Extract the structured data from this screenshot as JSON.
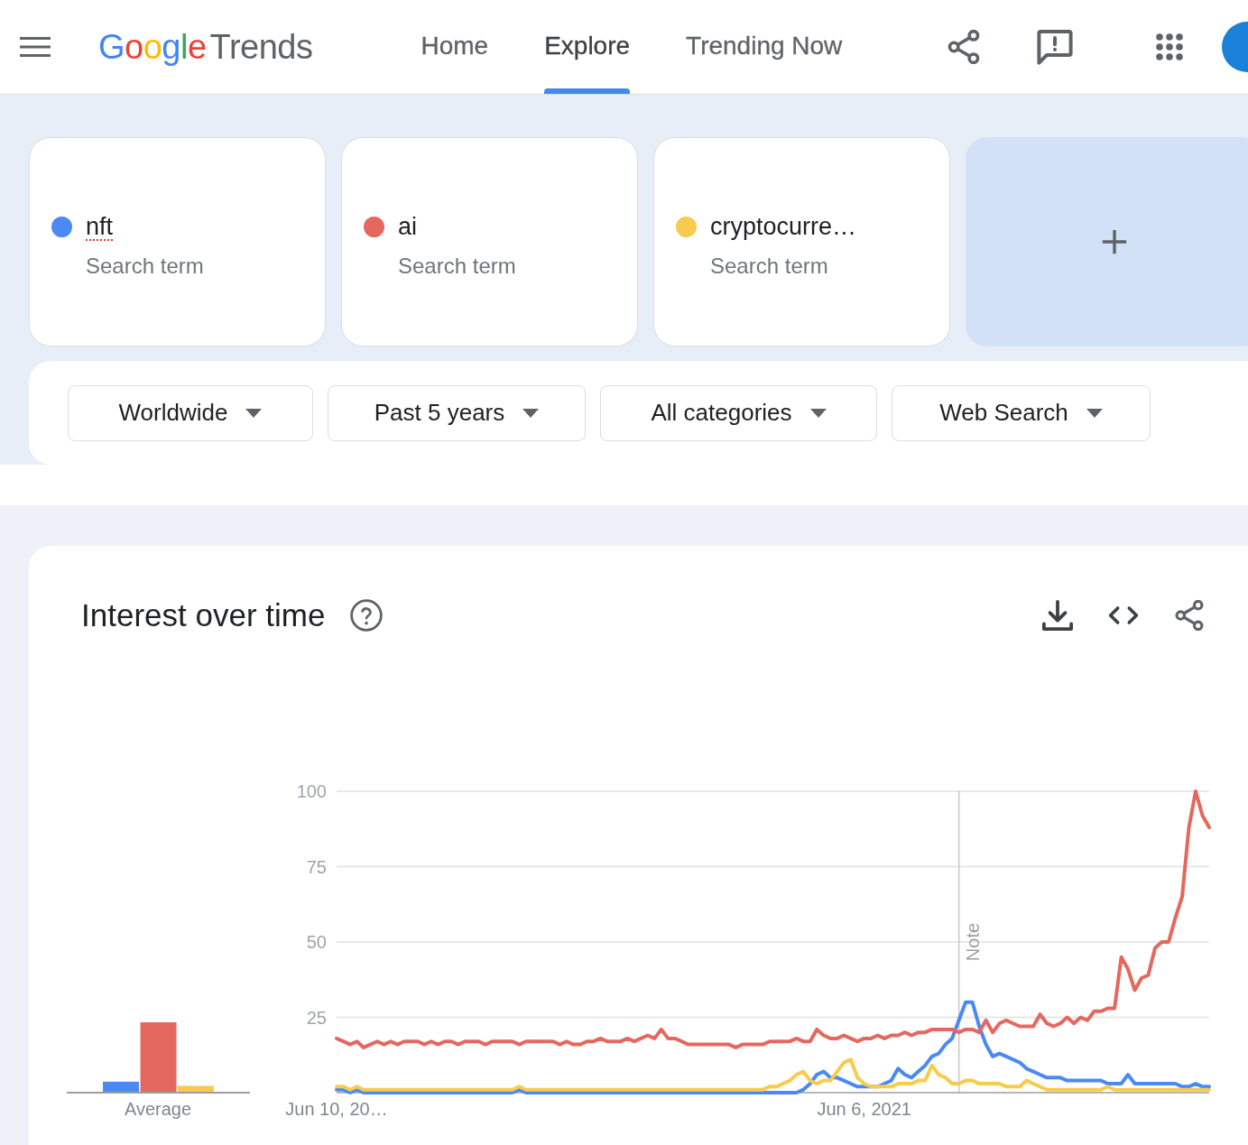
{
  "header": {
    "logo": {
      "brand": "Google",
      "product": "Trends"
    },
    "nav": [
      {
        "label": "Home",
        "selected": false
      },
      {
        "label": "Explore",
        "selected": true
      },
      {
        "label": "Trending Now",
        "selected": false
      }
    ]
  },
  "terms": [
    {
      "name": "nft",
      "type": "Search term",
      "color": "#4a8af4",
      "misspelled": true
    },
    {
      "name": "ai",
      "type": "Search term",
      "color": "#e4685d",
      "misspelled": false
    },
    {
      "name": "cryptocurre…",
      "type": "Search term",
      "color": "#f7cb4d",
      "misspelled": false
    }
  ],
  "filters": [
    "Worldwide",
    "Past 5 years",
    "All categories",
    "Web Search"
  ],
  "interest_chart": {
    "title": "Interest over time",
    "average_label": "Average",
    "chart_data": {
      "type": "line",
      "grid": true,
      "ylim": [
        0,
        100
      ],
      "yticks": [
        25,
        50,
        75,
        100
      ],
      "categories": [
        "Jun 10, 20…",
        null,
        null,
        null,
        null,
        null,
        null,
        null,
        null,
        null,
        null,
        null,
        null,
        null,
        null,
        null,
        null,
        null,
        null,
        null,
        null,
        null,
        null,
        null,
        null,
        null,
        null,
        null,
        null,
        null,
        null,
        null,
        null,
        null,
        null,
        null,
        null,
        null,
        null,
        null,
        null,
        null,
        null,
        null,
        null,
        null,
        null,
        null,
        null,
        null,
        null,
        null,
        null,
        null,
        null,
        null,
        null,
        null,
        null,
        null,
        null,
        null,
        null,
        null,
        null,
        null,
        null,
        null,
        null,
        null,
        null,
        null,
        null,
        null,
        null,
        null,
        null,
        null,
        "Jun 6, 2021",
        null,
        null,
        null,
        null,
        null,
        null,
        null,
        null,
        null,
        null,
        null,
        null,
        null,
        null,
        null,
        null,
        null,
        null,
        null,
        null,
        null,
        null,
        null,
        null,
        null,
        null,
        null,
        null,
        null,
        null,
        null,
        null,
        null,
        null,
        null,
        null,
        null,
        null,
        null,
        null,
        null,
        null,
        null,
        null,
        null,
        null,
        null,
        null,
        null,
        null,
        null
      ],
      "annotations": [
        "Note"
      ],
      "series": [
        {
          "color": "#4a8af4",
          "values": [
            1,
            1,
            0,
            1,
            0,
            0,
            0,
            0,
            0,
            0,
            0,
            0,
            0,
            0,
            0,
            0,
            0,
            0,
            0,
            0,
            0,
            0,
            0,
            0,
            0,
            0,
            0,
            1,
            0,
            0,
            0,
            0,
            0,
            0,
            0,
            0,
            0,
            0,
            0,
            0,
            0,
            0,
            0,
            0,
            0,
            0,
            0,
            0,
            0,
            0,
            0,
            0,
            0,
            0,
            0,
            0,
            0,
            0,
            0,
            0,
            0,
            0,
            0,
            0,
            0,
            0,
            0,
            0,
            0,
            1,
            3,
            6,
            7,
            5,
            5,
            4,
            3,
            2,
            2,
            2,
            2,
            3,
            4,
            8,
            6,
            5,
            7,
            9,
            12,
            13,
            16,
            18,
            24,
            30,
            30,
            22,
            16,
            12,
            13,
            12,
            11,
            10,
            8,
            7,
            6,
            5,
            5,
            5,
            4,
            4,
            4,
            4,
            4,
            4,
            3,
            3,
            3,
            6,
            3,
            3,
            3,
            3,
            3,
            3,
            3,
            2,
            2,
            3,
            2,
            2
          ]
        },
        {
          "color": "#e4685d",
          "values": [
            18,
            17,
            16,
            17,
            15,
            16,
            17,
            16,
            17,
            16,
            17,
            17,
            17,
            16,
            17,
            16,
            17,
            17,
            16,
            17,
            17,
            17,
            16,
            17,
            17,
            17,
            17,
            16,
            17,
            17,
            17,
            17,
            17,
            16,
            17,
            16,
            16,
            17,
            17,
            18,
            17,
            17,
            17,
            18,
            17,
            18,
            19,
            18,
            21,
            18,
            18,
            17,
            16,
            16,
            16,
            16,
            16,
            16,
            16,
            15,
            16,
            16,
            16,
            16,
            17,
            17,
            17,
            17,
            18,
            17,
            17,
            21,
            19,
            18,
            18,
            19,
            18,
            17,
            18,
            18,
            19,
            18,
            19,
            19,
            20,
            19,
            20,
            20,
            21,
            21,
            21,
            21,
            20,
            21,
            21,
            20,
            24,
            20,
            23,
            24,
            23,
            22,
            22,
            22,
            26,
            23,
            22,
            23,
            25,
            23,
            25,
            24,
            27,
            27,
            28,
            28,
            45,
            41,
            34,
            38,
            39,
            48,
            50,
            50,
            58,
            65,
            88,
            100,
            92,
            88
          ]
        },
        {
          "color": "#f7cb4d",
          "values": [
            2,
            2,
            1,
            2,
            1,
            1,
            1,
            1,
            1,
            1,
            1,
            1,
            1,
            1,
            1,
            1,
            1,
            1,
            1,
            1,
            1,
            1,
            1,
            1,
            1,
            1,
            1,
            2,
            1,
            1,
            1,
            1,
            1,
            1,
            1,
            1,
            1,
            1,
            1,
            1,
            1,
            1,
            1,
            1,
            1,
            1,
            1,
            1,
            1,
            1,
            1,
            1,
            1,
            1,
            1,
            1,
            1,
            1,
            1,
            1,
            1,
            1,
            1,
            1,
            2,
            2,
            3,
            4,
            6,
            7,
            4,
            3,
            4,
            4,
            7,
            10,
            11,
            5,
            3,
            2,
            2,
            2,
            2,
            3,
            3,
            3,
            4,
            4,
            9,
            6,
            5,
            3,
            3,
            4,
            4,
            3,
            3,
            3,
            3,
            2,
            2,
            2,
            4,
            3,
            2,
            1,
            1,
            1,
            1,
            1,
            1,
            1,
            1,
            1,
            2,
            1,
            1,
            1,
            1,
            1,
            1,
            1,
            1,
            1,
            1,
            1,
            1,
            1,
            1,
            1
          ]
        }
      ]
    }
  }
}
